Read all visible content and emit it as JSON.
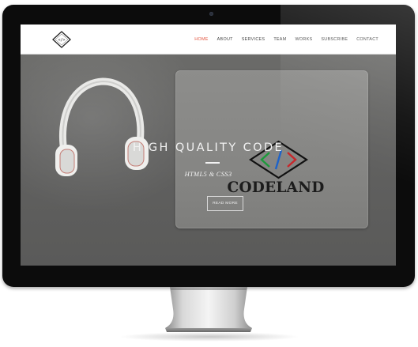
{
  "navbar": {
    "logo_icon": "codeland-logo-icon",
    "links": [
      {
        "label": "HOME",
        "active": true
      },
      {
        "label": "ABOUT",
        "active": false
      },
      {
        "label": "SERVICES",
        "active": false
      },
      {
        "label": "TEAM",
        "active": false
      },
      {
        "label": "WORKS",
        "active": false
      },
      {
        "label": "SUBSCRIBE",
        "active": false
      },
      {
        "label": "CONTACT",
        "active": false
      }
    ],
    "active_color": "#e2543f"
  },
  "hero": {
    "title": "HIGH QUALITY CODE",
    "subtitle": "HTML5 & CSS3",
    "button_label": "READ MORE",
    "laptop_sticker_text": "CODELAND",
    "laptop_sticker_symbol": "</>"
  },
  "device": {
    "frame_color": "#0c0c0c",
    "icons": [
      "camera-icon",
      "headphones-icon",
      "code-symbol-icon"
    ]
  }
}
